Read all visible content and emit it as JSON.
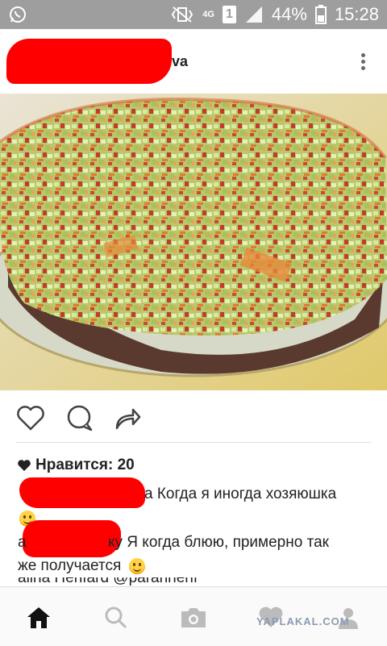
{
  "status_bar": {
    "network": "4G",
    "sim": "1",
    "battery": "44%",
    "time": "15:28",
    "icons": [
      "whatsapp-icon",
      "vibrate-mute-icon",
      "signal-icon",
      "battery-icon"
    ]
  },
  "post": {
    "username_suffix": "va",
    "likes": "Нравится: 20",
    "comments": [
      {
        "text": "а Когда я иногда хозяюшка",
        "emoji": "slightly-smiling-emoji"
      },
      {
        "prefix": "а",
        "text": "ку Я когда блюю, примерно так",
        "text2": "же получается",
        "emoji": "grinning-sweat-emoji"
      }
    ],
    "truncated_line": "alina Henfard @parahnenf"
  },
  "nav": [
    "home-icon",
    "search-icon",
    "camera-icon",
    "activity-icon",
    "profile-icon"
  ],
  "watermark": "YAPLAKAL.COM",
  "colors": {
    "status_bar": "#9e9e9e",
    "redaction": "#ff0000",
    "text": "#222222"
  }
}
